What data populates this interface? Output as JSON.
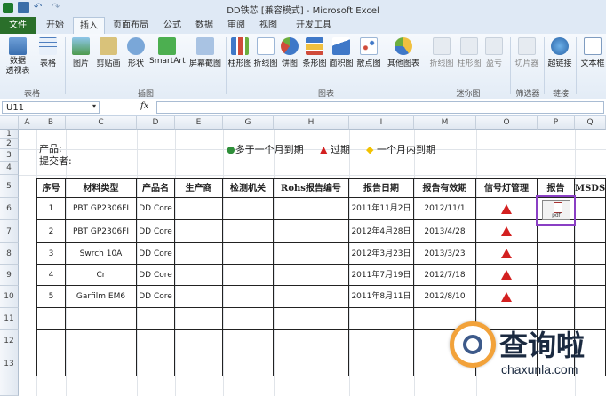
{
  "window": {
    "title": "DD铁芯 [兼容模式] - Microsoft Excel"
  },
  "tabs": [
    "文件",
    "开始",
    "插入",
    "页面布局",
    "公式",
    "数据",
    "审阅",
    "视图",
    "开发工具"
  ],
  "ribbon": {
    "buttons": [
      {
        "label": "数据\n透视表",
        "icon": "pivot-table-icon"
      },
      {
        "label": "表格",
        "icon": "table-icon"
      },
      {
        "label": "图片",
        "icon": "picture-icon"
      },
      {
        "label": "剪贴画",
        "icon": "clipart-icon"
      },
      {
        "label": "形状",
        "icon": "shapes-icon"
      },
      {
        "label": "SmartArt",
        "icon": "smartart-icon"
      },
      {
        "label": "屏幕截图",
        "icon": "screenshot-icon"
      },
      {
        "label": "柱形图",
        "icon": "column-chart-icon"
      },
      {
        "label": "折线图",
        "icon": "line-chart-icon"
      },
      {
        "label": "饼图",
        "icon": "pie-chart-icon"
      },
      {
        "label": "条形图",
        "icon": "bar-chart-icon"
      },
      {
        "label": "面积图",
        "icon": "area-chart-icon"
      },
      {
        "label": "散点图",
        "icon": "scatter-chart-icon"
      },
      {
        "label": "其他图表",
        "icon": "other-chart-icon"
      },
      {
        "label": "折线图",
        "icon": "sparkline-line-icon"
      },
      {
        "label": "柱形图",
        "icon": "sparkline-column-icon"
      },
      {
        "label": "盈亏",
        "icon": "sparkline-winloss-icon"
      },
      {
        "label": "切片器",
        "icon": "slicer-icon"
      },
      {
        "label": "超链接",
        "icon": "hyperlink-icon"
      },
      {
        "label": "文本框",
        "icon": "textbox-icon"
      }
    ],
    "groups": [
      "表格",
      "插图",
      "图表",
      "迷你图",
      "筛选器",
      "链接"
    ]
  },
  "formula_bar": {
    "name_box": "U11",
    "fx": "fx",
    "value": ""
  },
  "columns": [
    "A",
    "B",
    "C",
    "D",
    "E",
    "G",
    "H",
    "I",
    "M",
    "O",
    "P",
    "Q"
  ],
  "rows": [
    "1",
    "2",
    "3",
    "4",
    "5",
    "6",
    "7",
    "8",
    "9",
    "10",
    "11",
    "12",
    "13"
  ],
  "sheet": {
    "product_label": "产品:",
    "submitter_label": "提交者:",
    "legend": [
      {
        "symbol": "●",
        "text": "多于一个月到期",
        "color": "#2f8f3a"
      },
      {
        "symbol": "▲",
        "text": "过期",
        "color": "#d32020"
      },
      {
        "symbol": "◆",
        "text": "一个月内到期",
        "color": "#f2c200"
      }
    ],
    "headers": [
      "序号",
      "材料类型",
      "产品名",
      "生产商",
      "检测机关",
      "Rohs报告编号",
      "报告日期",
      "报告有效期",
      "信号灯管理",
      "报告",
      "MSDS"
    ],
    "rows": [
      {
        "no": "1",
        "material": "PBT GP2306FI",
        "product": "DD Core",
        "report_date": "2011年11月2日",
        "valid": "2012/11/1",
        "signal": "expired"
      },
      {
        "no": "2",
        "material": "PBT GP2306FI",
        "product": "DD Core",
        "report_date": "2012年4月28日",
        "valid": "2013/4/28",
        "signal": "expired"
      },
      {
        "no": "3",
        "material": "Swrch 10A",
        "product": "DD Core",
        "report_date": "2012年3月23日",
        "valid": "2013/3/23",
        "signal": "expired"
      },
      {
        "no": "4",
        "material": "Cr",
        "product": "DD Core",
        "report_date": "2011年7月19日",
        "valid": "2012/7/18",
        "signal": "expired"
      },
      {
        "no": "5",
        "material": "Garfilm EM6",
        "product": "DD Core",
        "report_date": "2011年8月11日",
        "valid": "2012/8/10",
        "signal": "expired"
      }
    ],
    "report_attachment": "pdf"
  },
  "watermark": {
    "brand": "查询啦",
    "url": "chaxunla.com"
  }
}
